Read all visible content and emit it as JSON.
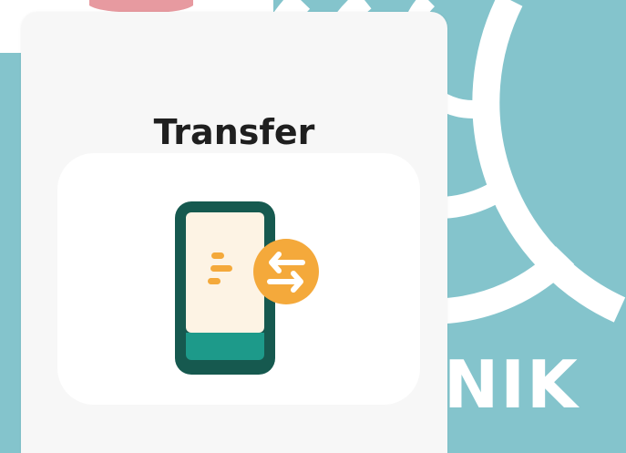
{
  "card": {
    "title": "Transfer",
    "icon": "phone-transfer-icon"
  },
  "background": {
    "brand_text": "NIK",
    "colors": {
      "teal": "#84c4cc",
      "pink": "#e79aa0",
      "white": "#ffffff"
    }
  },
  "colors": {
    "card_bg": "#f7f7f7",
    "tile_bg": "#ffffff",
    "title": "#1f1f1f",
    "phone_outline": "#16594f",
    "phone_screen": "#fdf3e4",
    "phone_bottom": "#1d9a8a",
    "accent_orange": "#f4a93b"
  }
}
